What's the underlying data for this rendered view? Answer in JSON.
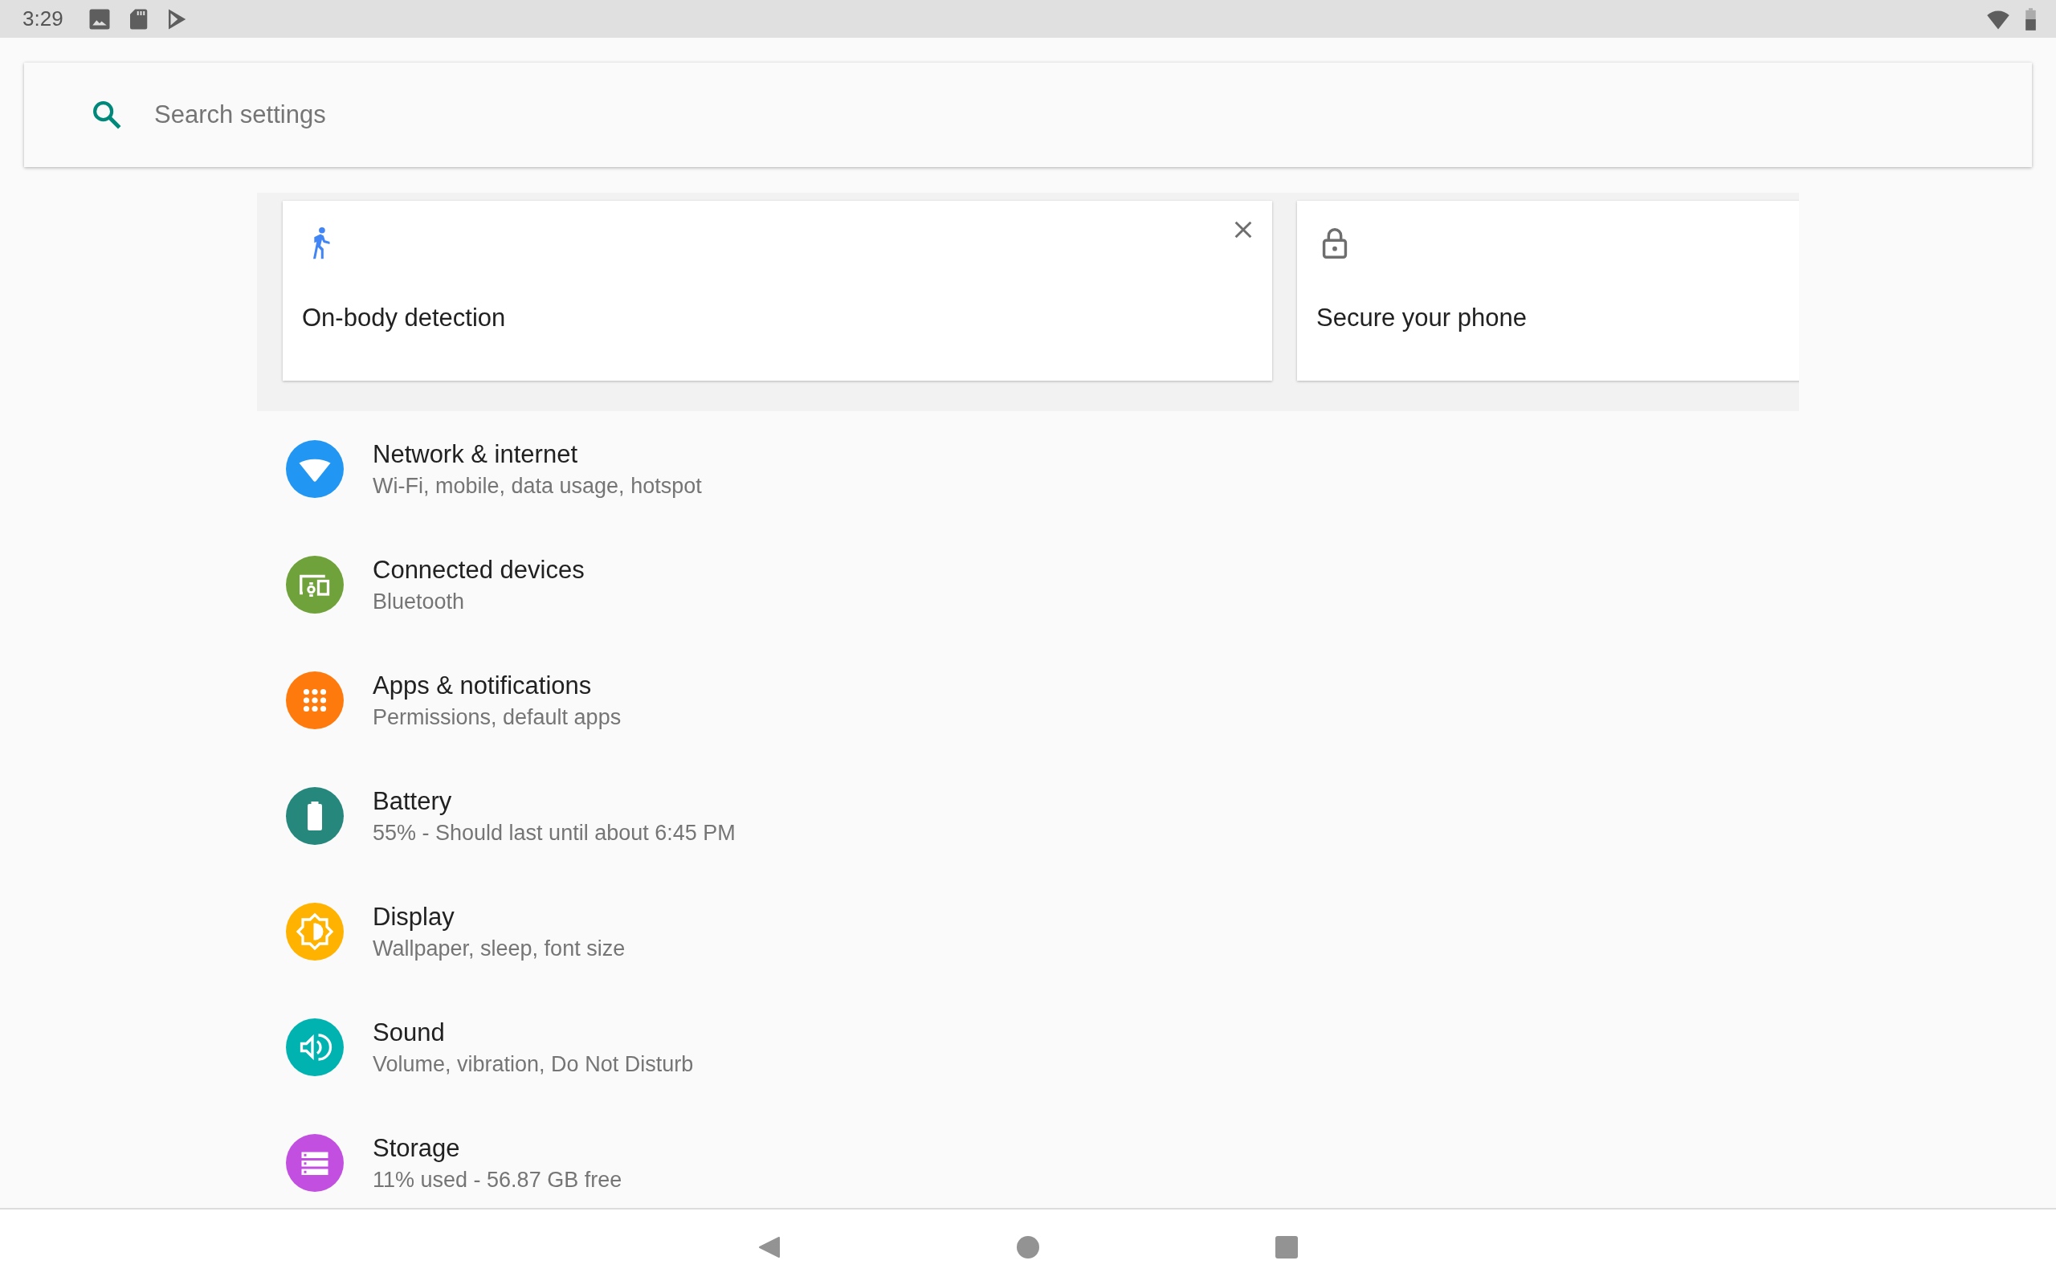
{
  "status_bar": {
    "time": "3:29"
  },
  "search": {
    "placeholder": "Search settings"
  },
  "suggestions": [
    {
      "kind": "walker",
      "title": "On-body detection",
      "dismissible": true
    },
    {
      "kind": "lock",
      "title": "Secure your phone"
    }
  ],
  "settings": [
    {
      "kind": "network",
      "title": "Network & internet",
      "summary": "Wi-Fi, mobile, data usage, hotspot",
      "color": "#2196f3"
    },
    {
      "kind": "devices",
      "title": "Connected devices",
      "summary": "Bluetooth",
      "color": "#6fa23a"
    },
    {
      "kind": "apps",
      "title": "Apps & notifications",
      "summary": "Permissions, default apps",
      "color": "#ff7a0d"
    },
    {
      "kind": "battery",
      "title": "Battery",
      "summary": "55% - Should last until about 6:45 PM",
      "color": "#26877d"
    },
    {
      "kind": "display",
      "title": "Display",
      "summary": "Wallpaper, sleep, font size",
      "color": "#ffb300"
    },
    {
      "kind": "sound",
      "title": "Sound",
      "summary": "Volume, vibration, Do Not Disturb",
      "color": "#00b3b0"
    },
    {
      "kind": "storage",
      "title": "Storage",
      "summary": "11% used - 56.87 GB free",
      "color": "#c24fe0"
    }
  ]
}
